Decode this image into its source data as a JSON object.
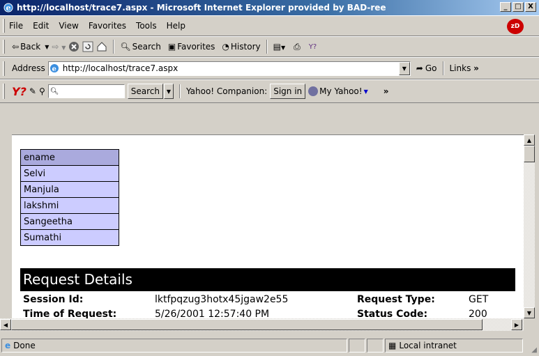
{
  "window": {
    "title": "http://localhost/trace7.aspx - Microsoft Internet Explorer provided by BAD-ree",
    "min": "_",
    "max": "□",
    "close": "X"
  },
  "menu": [
    "File",
    "Edit",
    "View",
    "Favorites",
    "Tools",
    "Help"
  ],
  "brand": "zD",
  "nav": {
    "back": "Back",
    "search": "Search",
    "favorites": "Favorites",
    "history": "History"
  },
  "address": {
    "label": "Address",
    "url": "http://localhost/trace7.aspx",
    "go": "Go",
    "links": "Links"
  },
  "yahoo": {
    "logo": "Y?",
    "search": "Search",
    "companion": "Yahoo! Companion:",
    "signin": "Sign in",
    "myyahoo": "My Yahoo!",
    "more": "»"
  },
  "table": {
    "header": "ename",
    "rows": [
      "Selvi",
      "Manjula",
      "lakshmi",
      "Sangeetha",
      "Sumathi"
    ]
  },
  "request": {
    "title": "Request Details",
    "session_label": "Session Id:",
    "session_value": "lktfpqzug3hotx45jgaw2e55",
    "type_label": "Request Type:",
    "type_value": "GET",
    "time_label": "Time of Request:",
    "time_value": "5/26/2001 12:57:40 PM",
    "status_label": "Status Code:",
    "status_value": "200"
  },
  "status": {
    "text": "Done",
    "zone": "Local intranet"
  }
}
